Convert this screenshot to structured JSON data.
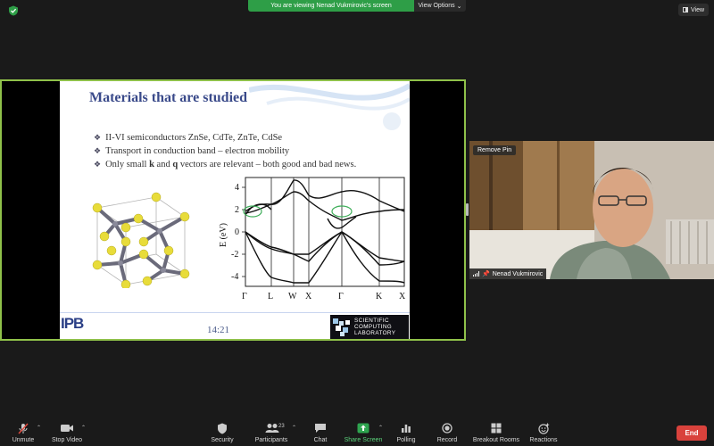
{
  "banner": {
    "message": "You are viewing Nenad Vukmirovic's screen",
    "options_label": "View Options"
  },
  "view_button": {
    "label": "View"
  },
  "slide": {
    "title": "Materials that are studied",
    "bullets": [
      {
        "text": "II-VI semiconductors ZnSe, CdTe, ZnTe, CdSe"
      },
      {
        "text": "Transport in conduction band – electron mobility"
      },
      {
        "pre": "Only small ",
        "k": "k",
        "mid": " and ",
        "q": "q",
        "post": " vectors are relevant – both good and bad news."
      }
    ],
    "time": "14:21",
    "logo_left_text": "IPB",
    "logo_right_lines": [
      "SCIENTIFIC",
      "COMPUTING",
      "LABORATORY"
    ],
    "band_plot": {
      "ylabel": "E (eV)",
      "yticks": [
        "4",
        "2",
        "0",
        "-2",
        "-4"
      ],
      "xticks": [
        "Γ",
        "L",
        "W",
        "X",
        "Γ",
        "K",
        "X"
      ]
    }
  },
  "video": {
    "remove_pin_label": "Remove Pin",
    "participant_name": "Nenad Vukmirovic"
  },
  "toolbar": {
    "unmute": "Unmute",
    "stop_video": "Stop Video",
    "security": "Security",
    "participants": "Participants",
    "participants_count": "23",
    "chat": "Chat",
    "share_screen": "Share Screen",
    "polling": "Polling",
    "record": "Record",
    "breakout_rooms": "Breakout Rooms",
    "reactions": "Reactions",
    "end": "End"
  },
  "colors": {
    "share_border": "#8fc14a",
    "banner_green": "#2e9e47",
    "end_red": "#d9423c",
    "slide_title": "#3a4a8a"
  }
}
